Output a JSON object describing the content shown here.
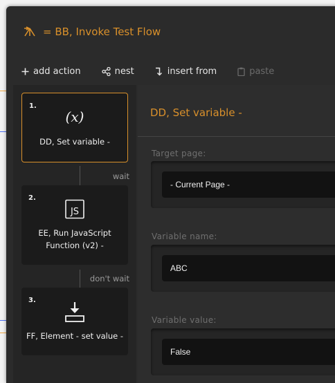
{
  "colors": {
    "accent": "#d9902b",
    "panel_bg": "#2b2b2b",
    "step_bg": "#1b1b1b",
    "input_bg": "#121212",
    "bg_line_orange": "#f0a640",
    "bg_line_blue": "#4a6cf0"
  },
  "window": {
    "title": "= BB, Invoke Test Flow",
    "logo_icon": "flow-logo-icon"
  },
  "toolbar": {
    "add_action": "add action",
    "nest": "nest",
    "insert_from": "insert from",
    "paste": "paste"
  },
  "steps": [
    {
      "number": "1.",
      "label": "DD, Set variable -",
      "icon": "variable-x-icon",
      "selected": true
    },
    {
      "number": "2.",
      "label": "EE, Run JavaScript Function (v2) -",
      "icon": "javascript-icon",
      "selected": false
    },
    {
      "number": "3.",
      "label": "FF, Element - set value -",
      "icon": "download-set-value-icon",
      "selected": false
    }
  ],
  "connectors": [
    "wait",
    "don't wait"
  ],
  "detail": {
    "title": "DD, Set variable -",
    "fields": [
      {
        "label": "Target page:",
        "value": "- Current Page -"
      },
      {
        "label": "Variable name:",
        "value": "ABC"
      },
      {
        "label": "Variable value:",
        "value": "False"
      }
    ]
  }
}
